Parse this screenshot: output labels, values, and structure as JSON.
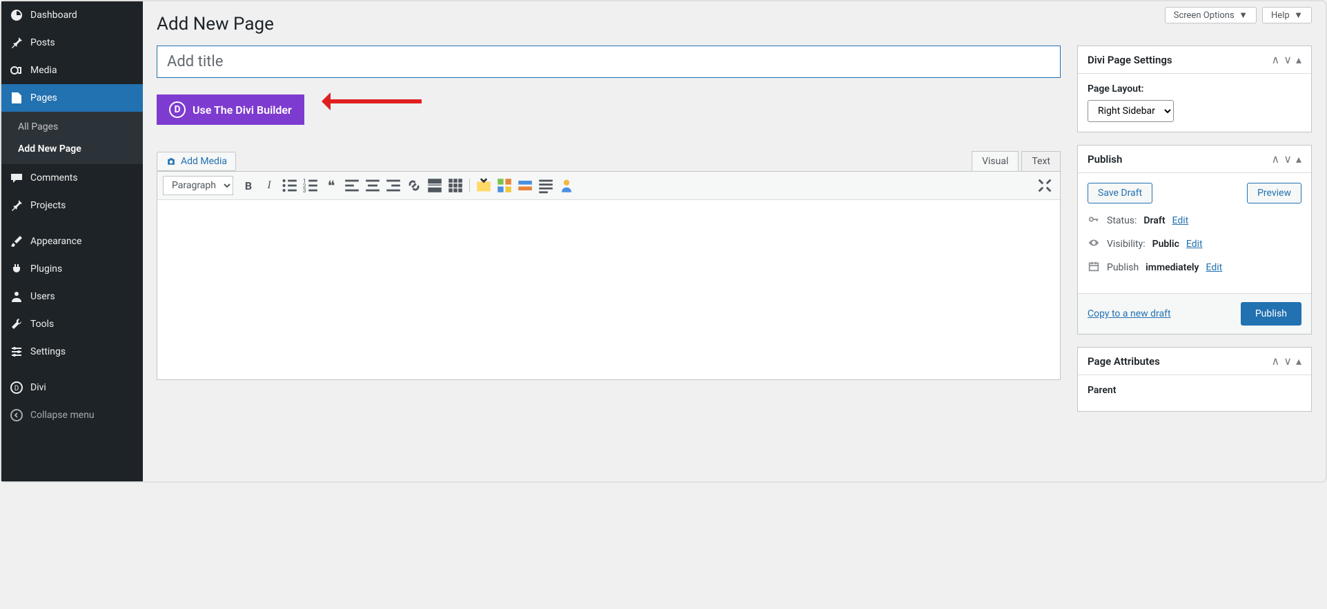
{
  "top": {
    "screen_options": "Screen Options",
    "help": "Help"
  },
  "sidebar": {
    "items": [
      {
        "label": "Dashboard"
      },
      {
        "label": "Posts"
      },
      {
        "label": "Media"
      },
      {
        "label": "Pages"
      },
      {
        "label": "Comments"
      },
      {
        "label": "Projects"
      },
      {
        "label": "Appearance"
      },
      {
        "label": "Plugins"
      },
      {
        "label": "Users"
      },
      {
        "label": "Tools"
      },
      {
        "label": "Settings"
      },
      {
        "label": "Divi"
      },
      {
        "label": "Collapse menu"
      }
    ],
    "submenu": {
      "all": "All Pages",
      "add": "Add New Page"
    }
  },
  "page": {
    "heading": "Add New Page",
    "title_placeholder": "Add title"
  },
  "divi": {
    "button": "Use The Divi Builder",
    "logo_letter": "D"
  },
  "editor": {
    "add_media": "Add Media",
    "tab_visual": "Visual",
    "tab_text": "Text",
    "format_select": "Paragraph"
  },
  "metabox": {
    "divi_settings": {
      "title": "Divi Page Settings",
      "layout_label": "Page Layout:",
      "layout_value": "Right Sidebar"
    },
    "publish": {
      "title": "Publish",
      "save_draft": "Save Draft",
      "preview": "Preview",
      "status_label": "Status:",
      "status_value": "Draft",
      "visibility_label": "Visibility:",
      "visibility_value": "Public",
      "publish_label": "Publish",
      "publish_value": "immediately",
      "edit": "Edit",
      "copy": "Copy to a new draft",
      "publish_btn": "Publish"
    },
    "attributes": {
      "title": "Page Attributes",
      "parent_label": "Parent"
    }
  }
}
